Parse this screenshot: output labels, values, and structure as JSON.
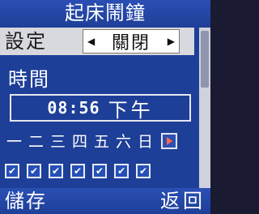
{
  "title": "起床鬧鐘",
  "setting": {
    "label": "設定",
    "value": "關閉",
    "left_arrow": "◀",
    "right_arrow": "▶"
  },
  "time_label": "時間",
  "time": {
    "value": "08:56",
    "ampm": "下午"
  },
  "days": [
    "一",
    "二",
    "三",
    "四",
    "五",
    "六",
    "日"
  ],
  "days_checked": [
    true,
    true,
    true,
    true,
    true,
    true,
    true
  ],
  "check_mark": "✔",
  "softkeys": {
    "left": "儲存",
    "right": "返回"
  },
  "colors": {
    "background": "#1e3f98",
    "highlight_row": "#d8d9de",
    "next_arrow": "#ff6a4a"
  }
}
